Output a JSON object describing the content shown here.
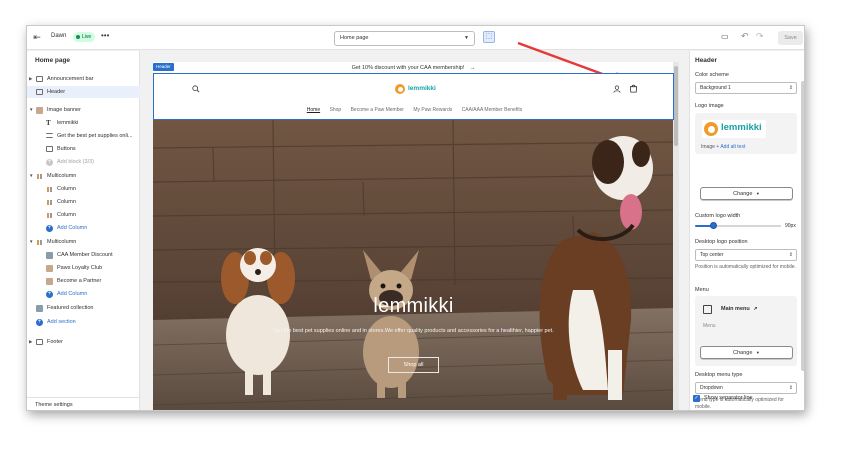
{
  "topbar": {
    "theme_name": "Dawn",
    "live_badge": "Live",
    "more_label": "•••",
    "page_select": "Home page",
    "save_label": "Save"
  },
  "sidebar": {
    "title": "Home page",
    "items": [
      {
        "label": "Announcement bar"
      },
      {
        "label": "Header"
      },
      {
        "label": "Image banner"
      },
      {
        "label": "lemmikki"
      },
      {
        "label": "Get the best pet supplies onli..."
      },
      {
        "label": "Buttons"
      },
      {
        "label": "Add block (3/3)"
      },
      {
        "label": "Multicolumn"
      },
      {
        "label": "Column"
      },
      {
        "label": "Column"
      },
      {
        "label": "Column"
      },
      {
        "label": "Add Column"
      },
      {
        "label": "Multicolumn"
      },
      {
        "label": "CAA Member Discount"
      },
      {
        "label": "Paws Loyalty Club"
      },
      {
        "label": "Become a Partner"
      },
      {
        "label": "Add Column"
      },
      {
        "label": "Featured collection"
      },
      {
        "label": "Add section"
      },
      {
        "label": "Footer"
      }
    ],
    "footer_label": "Theme settings"
  },
  "preview": {
    "announcement": "Get 10% discount with your CAA membership!",
    "announcement_arrow": "→",
    "header_tag": "Header",
    "logo_text": "lemmikki",
    "nav": [
      "Home",
      "Shop",
      "Become a Paw Member",
      "My Paw Rewards",
      "CAA/AAA Member Benefits"
    ],
    "banner": {
      "title": "lemmikki",
      "subtitle": "Get the best pet supplies online and in stores.We offer quality products and accessories for a healthier, happier pet.",
      "button": "Shop all"
    }
  },
  "panel": {
    "title": "Header",
    "color_scheme_label": "Color scheme",
    "color_scheme_value": "Background 1",
    "logo_image_label": "Logo image",
    "logo_text": "lemmikki",
    "image_word": "Image",
    "add_alt_text": "+ Add alt text",
    "change_label": "Change",
    "custom_logo_width_label": "Custom logo width",
    "logo_width_value": "90px",
    "logo_width_fraction": 0.22,
    "desktop_logo_position_label": "Desktop logo position",
    "desktop_logo_position_value": "Top center",
    "logo_position_help": "Position is automatically optimized for mobile.",
    "menu_label": "Menu",
    "menu_name": "Main menu",
    "menu_sub": "Menu",
    "menu_change_label": "Change",
    "desktop_menu_type_label": "Desktop menu type",
    "desktop_menu_type_value": "Dropdown",
    "menu_type_help": "Menu type is automatically optimized for mobile.",
    "separator_label": "Show separator line"
  },
  "colors": {
    "accent": "#2c6ecb",
    "logo_orange": "#f09a2a",
    "logo_teal": "#17a2a4",
    "live_green": "#29845a",
    "annotation_arrow": "#e53935"
  }
}
